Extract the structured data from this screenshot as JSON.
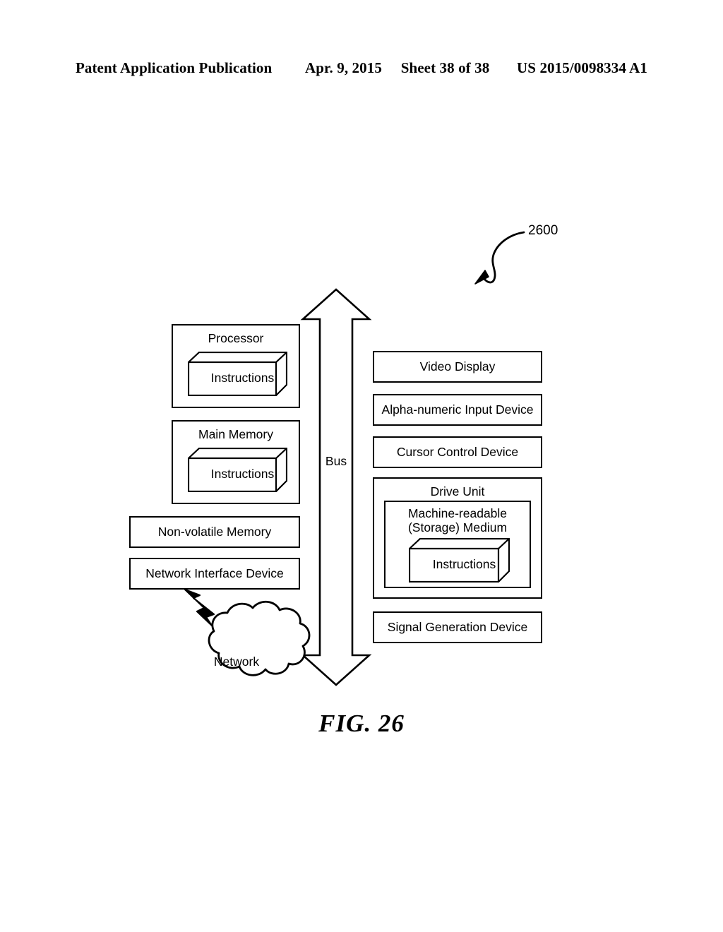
{
  "header": {
    "publication": "Patent Application Publication",
    "date": "Apr. 9, 2015",
    "sheet": "Sheet 38 of 38",
    "number": "US 2015/0098334 A1"
  },
  "figure": {
    "caption": "FIG. 26",
    "reference_numeral": "2600",
    "bus_label": "Bus",
    "network_label": "Network",
    "left_column": [
      {
        "id": "processor",
        "label": "Processor",
        "inner_cube": "Instructions"
      },
      {
        "id": "main-memory",
        "label": "Main Memory",
        "inner_cube": "Instructions"
      },
      {
        "id": "non-volatile-memory",
        "label": "Non-volatile Memory"
      },
      {
        "id": "network-interface-device",
        "label": "Network Interface Device"
      }
    ],
    "right_column": [
      {
        "id": "video-display",
        "label": "Video Display"
      },
      {
        "id": "alpha-numeric-input-device",
        "label": "Alpha-numeric Input Device"
      },
      {
        "id": "cursor-control-device",
        "label": "Cursor Control Device"
      },
      {
        "id": "drive-unit",
        "label": "Drive Unit",
        "inner_block_line1": "Machine-readable",
        "inner_block_line2": "(Storage) Medium",
        "inner_cube": "Instructions"
      },
      {
        "id": "signal-generation-device",
        "label": "Signal Generation Device"
      }
    ]
  },
  "colors": {
    "ink": "#000000",
    "paper": "#ffffff"
  }
}
